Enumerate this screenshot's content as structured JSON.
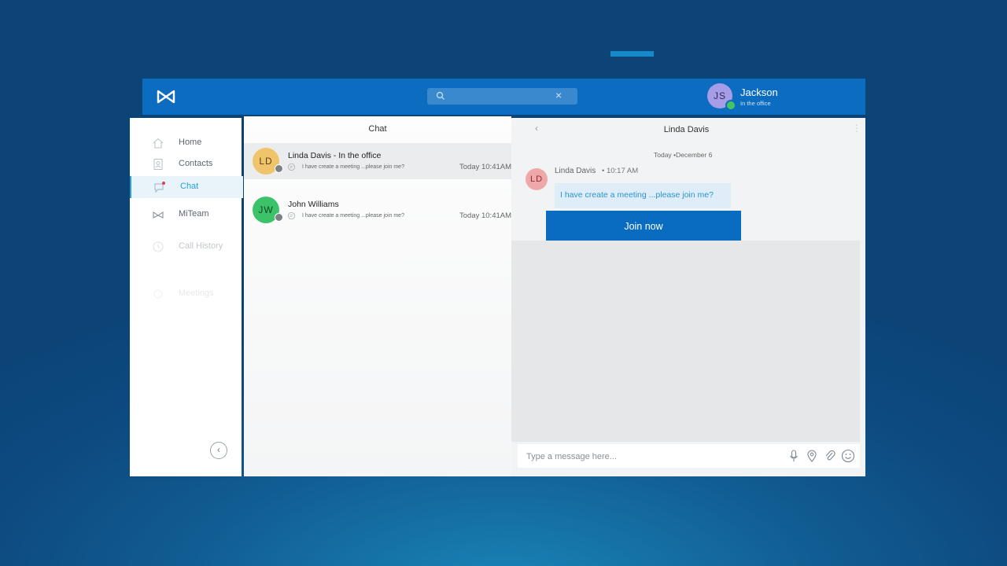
{
  "app": {
    "user": {
      "initials": "JS",
      "name": "Jackson",
      "status": "In the office"
    }
  },
  "sidebar": {
    "items": [
      {
        "label": "Home",
        "icon": "home-icon"
      },
      {
        "label": "Contacts",
        "icon": "contacts-icon"
      },
      {
        "label": "Chat",
        "icon": "chat-icon",
        "active": true
      },
      {
        "label": "MiTeam",
        "icon": "miteam-icon"
      },
      {
        "label": "Call History",
        "icon": "call-history-icon"
      },
      {
        "label": "Meetings",
        "icon": "meetings-icon"
      }
    ],
    "collapse_label": "‹"
  },
  "chatlist": {
    "title": "Chat",
    "conversations": [
      {
        "initials": "LD",
        "name": "Linda Davis - In the office",
        "preview": "I have create a meeting ...please join me?",
        "time": "Today 10:41AM",
        "avatar_color": "#f0c46b"
      },
      {
        "initials": "JW",
        "name": "John Williams",
        "preview": "I have create a meeting ...please join me?",
        "time": "Today 10:41AM",
        "avatar_color": "#3cc36a"
      }
    ]
  },
  "conversation": {
    "title": "Linda Davis",
    "date_separator": "Today •December 6",
    "message": {
      "initials": "LD",
      "sender": "Linda Davis",
      "time": "• 10:17 AM",
      "text": "I have create a meeting ...please join me?"
    },
    "join_label": "Join now",
    "composer_placeholder": "Type a message here..."
  },
  "colors": {
    "brand": "#0b6cc0",
    "accent": "#2aa0dd",
    "background": "#0d4a80"
  }
}
